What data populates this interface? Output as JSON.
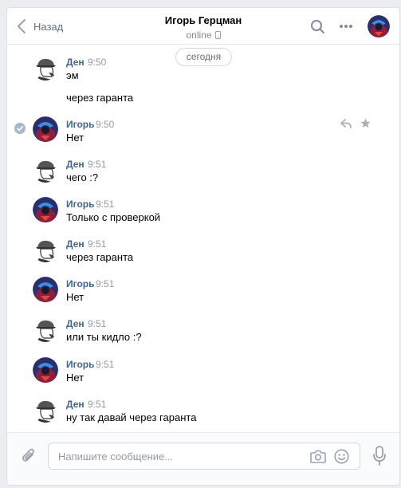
{
  "header": {
    "back_label": "Назад",
    "contact_name": "Игорь Герцман",
    "status": "online"
  },
  "date_divider": "сегодня",
  "messages": [
    {
      "author": "Ден",
      "time": "9:50",
      "lines": [
        "эм",
        "через гаранта"
      ],
      "avatar": "detective"
    },
    {
      "author": "Игорь",
      "time": "9:50",
      "lines": [
        "Нет"
      ],
      "avatar": "hero",
      "selected": true
    },
    {
      "author": "Ден",
      "time": "9:51",
      "lines": [
        "чего :?"
      ],
      "avatar": "detective"
    },
    {
      "author": "Игорь",
      "time": "9:51",
      "lines": [
        "Только с проверкой"
      ],
      "avatar": "hero"
    },
    {
      "author": "Ден",
      "time": "9:51",
      "lines": [
        "через гаранта"
      ],
      "avatar": "detective"
    },
    {
      "author": "Игорь",
      "time": "9:51",
      "lines": [
        "Нет"
      ],
      "avatar": "hero"
    },
    {
      "author": "Ден",
      "time": "9:51",
      "lines": [
        "или ты кидло :?"
      ],
      "avatar": "detective"
    },
    {
      "author": "Игорь",
      "time": "9:51",
      "lines": [
        "Нет"
      ],
      "avatar": "hero"
    },
    {
      "author": "Ден",
      "time": "9:51",
      "lines": [
        "ну так давай через гаранта"
      ],
      "avatar": "detective"
    }
  ],
  "composer": {
    "placeholder": "Напишите сообщение..."
  },
  "icons": [
    "back-chevron-icon",
    "phone-icon",
    "search-icon",
    "more-icon",
    "check-icon",
    "reply-icon",
    "star-icon",
    "paperclip-icon",
    "camera-icon",
    "smile-icon",
    "microphone-icon"
  ],
  "colors": {
    "author": "#42648b",
    "time": "#939aa3",
    "background": "#ebedf0",
    "accent": "#5181b8"
  }
}
